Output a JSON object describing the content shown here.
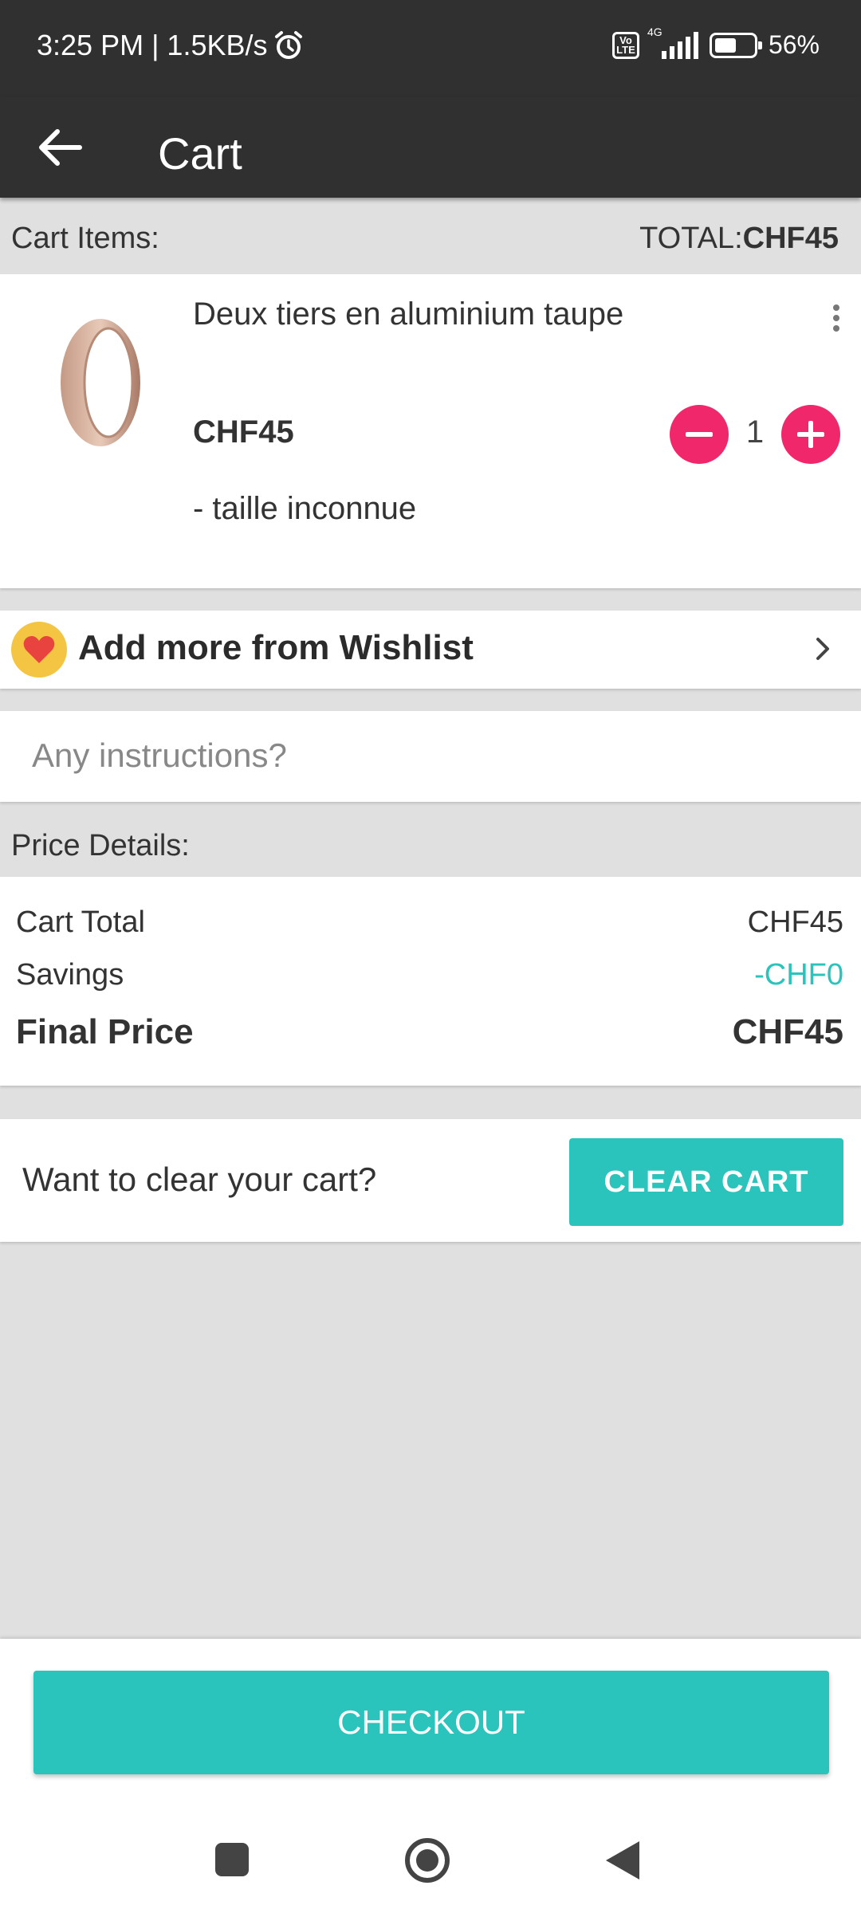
{
  "status_bar": {
    "time": "3:25 PM | 1.5KB/s",
    "volte": "Vo LTE",
    "network": "4G",
    "battery_level": 0.56,
    "battery_text": "56%"
  },
  "app_bar": {
    "title": "Cart"
  },
  "cart": {
    "items_label": "Cart Items:",
    "total_label": "TOTAL:",
    "total_value": "CHF45",
    "item": {
      "name": "Deux tiers en aluminium taupe",
      "price": "CHF45",
      "quantity": "1",
      "variant": "- taille inconnue"
    }
  },
  "wishlist": {
    "label": "Add more from Wishlist"
  },
  "instructions": {
    "placeholder": "Any instructions?"
  },
  "price_details": {
    "label": "Price Details:",
    "cart_total_label": "Cart Total",
    "cart_total_value": "CHF45",
    "savings_label": "Savings",
    "savings_value": "-CHF0",
    "final_label": "Final Price",
    "final_value": "CHF45"
  },
  "clear_cart": {
    "prompt": "Want to clear your cart?",
    "button": "CLEAR CART"
  },
  "checkout": {
    "button": "CHECKOUT"
  },
  "colors": {
    "accent": "#2bc4bc",
    "qty_button": "#f0286b",
    "app_bar": "#303030"
  },
  "icons": [
    "alarm-icon",
    "volte-icon",
    "signal-icon",
    "battery-icon",
    "back-arrow-icon",
    "more-vert-icon",
    "minus-icon",
    "plus-icon",
    "heart-icon",
    "chevron-right-icon",
    "nav-recent-icon",
    "nav-home-icon",
    "nav-back-icon"
  ]
}
